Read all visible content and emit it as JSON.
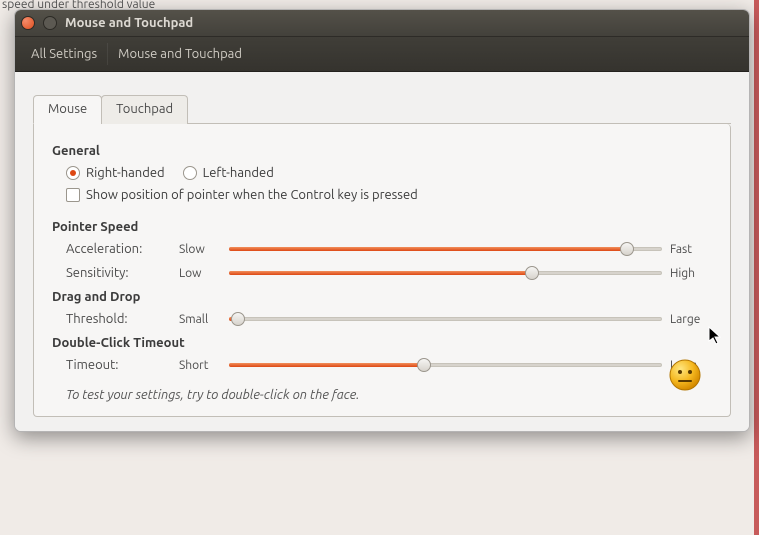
{
  "bg_text": "speed under threshold value",
  "window": {
    "title": "Mouse and Touchpad",
    "breadcrumb": [
      "All Settings",
      "Mouse and Touchpad"
    ]
  },
  "tabs": [
    "Mouse",
    "Touchpad"
  ],
  "active_tab": 0,
  "sections": {
    "general": {
      "title": "General",
      "radio": {
        "right": "Right-handed",
        "left": "Left-handed",
        "selected": "right"
      },
      "show_pointer": {
        "label": "Show position of pointer when the Control key is pressed",
        "checked": false
      }
    },
    "pointer_speed": {
      "title": "Pointer Speed",
      "acceleration": {
        "label": "Acceleration:",
        "low": "Slow",
        "high": "Fast",
        "value": 0.92
      },
      "sensitivity": {
        "label": "Sensitivity:",
        "low": "Low",
        "high": "High",
        "value": 0.7
      }
    },
    "drag_drop": {
      "title": "Drag and Drop",
      "threshold": {
        "label": "Threshold:",
        "low": "Small",
        "high": "Large",
        "value": 0.02
      }
    },
    "double_click": {
      "title": "Double-Click Timeout",
      "timeout": {
        "label": "Timeout:",
        "low": "Short",
        "high": "Long",
        "value": 0.45
      }
    },
    "hint": "To test your settings, try to double-click on the face."
  }
}
